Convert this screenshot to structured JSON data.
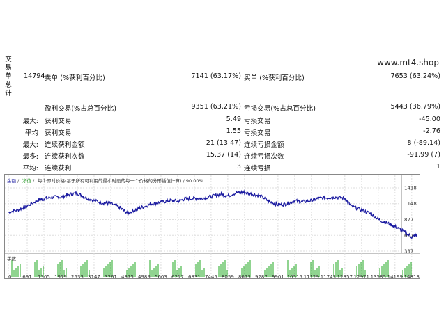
{
  "side_label": "交易单总计",
  "watermark": "www.mt4.shop",
  "summary": {
    "total_trades": "14794",
    "short_label": "卖单 (%获利百分比)",
    "short_value": "7141 (63.17%)",
    "long_label": "买单 (%获利百分比)",
    "long_value": "7653 (63.24%)"
  },
  "stats": [
    {
      "prefix": "",
      "label": "盈利交易(%占总百分比)",
      "value": "9351 (63.21%)",
      "label2": "亏损交易(%占总百分比)",
      "value2": "5443 (36.79%)"
    },
    {
      "prefix": "最大:",
      "label": "获利交易",
      "value": "5.49",
      "label2": "亏损交易",
      "value2": "-45.00"
    },
    {
      "prefix": "平均",
      "label": "获利交易",
      "value": "1.55",
      "label2": "亏损交易",
      "value2": "-2.76"
    },
    {
      "prefix": "最大:",
      "label": "连续获利金额",
      "value": "21 (13.47)",
      "label2": "连续亏损金额",
      "value2": "8 (-89.14)"
    },
    {
      "prefix": "最多:",
      "label": "连续获利次数",
      "value": "15.37 (14)",
      "label2": "连续亏损次数",
      "value2": "-91.99 (7)"
    },
    {
      "prefix": "平均:",
      "label": "连续获利",
      "value": "3",
      "label2": "连续亏损",
      "value2": "1"
    }
  ],
  "chart_header": {
    "balance": "余额",
    "sep1": " / ",
    "equity": "净值",
    "sep2": " / ",
    "rest": "每个即时价格(基于所有可利用的最小时段的每一个价格的分形插值计算) / 90.00%"
  },
  "lots_label": "手数",
  "chart_data": {
    "type": "line",
    "title": "",
    "xlabel": "",
    "ylabel": "",
    "x_ticks": [
      0,
      691,
      1305,
      1919,
      2533,
      3147,
      3761,
      4375,
      4989,
      5603,
      6217,
      6831,
      7445,
      8059,
      8673,
      9287,
      9901,
      10515,
      11129,
      11743,
      12357,
      12971,
      13585,
      14199,
      14813
    ],
    "y_ticks": [
      337,
      607,
      877,
      1148,
      1418
    ],
    "xlim": [
      0,
      15100
    ],
    "ylim": [
      337,
      1418
    ],
    "series": [
      {
        "color": "#1a1aa0",
        "x": [
          0,
          400,
          691,
          1100,
          1305,
          1600,
          1919,
          2200,
          2533,
          2800,
          3147,
          3500,
          3761,
          4100,
          4375,
          4700,
          4989,
          5300,
          5603,
          5900,
          6217,
          6500,
          6831,
          7100,
          7445,
          7800,
          8059,
          8400,
          8673,
          9000,
          9287,
          9600,
          9901,
          10200,
          10515,
          10800,
          11129,
          11400,
          11743,
          12000,
          12357,
          12600,
          12971,
          13300,
          13585,
          13900,
          14199,
          14500,
          14813,
          15000
        ],
        "y": [
          1000,
          1050,
          1110,
          1210,
          1230,
          1260,
          1260,
          1300,
          1330,
          1260,
          1200,
          1160,
          1150,
          1080,
          980,
          1050,
          1100,
          1150,
          1170,
          1200,
          1190,
          1230,
          1240,
          1240,
          1270,
          1310,
          1280,
          1340,
          1340,
          1310,
          1270,
          1180,
          1130,
          1140,
          1200,
          1180,
          1200,
          1240,
          1250,
          1260,
          1240,
          1100,
          1040,
          980,
          880,
          820,
          760,
          680,
          580,
          620
        ]
      }
    ]
  }
}
